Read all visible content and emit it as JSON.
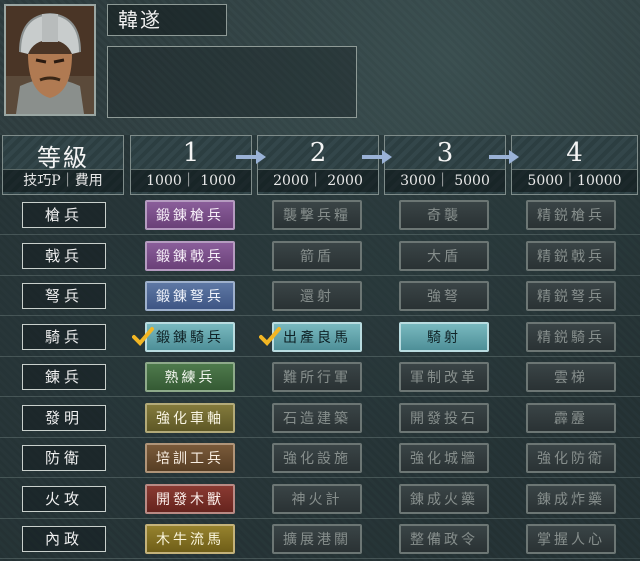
{
  "character": {
    "name": "韓遂"
  },
  "header": {
    "level_label": "等級",
    "cost_label": "技巧P｜費用",
    "levels": [
      {
        "level": "1",
        "cost": "1000｜ 1000"
      },
      {
        "level": "2",
        "cost": "2000｜ 2000"
      },
      {
        "level": "3",
        "cost": "3000｜ 5000"
      },
      {
        "level": "4",
        "cost": "5000｜10000"
      }
    ]
  },
  "rows": [
    {
      "label": "槍兵",
      "techs": [
        "鍛錬槍兵",
        "襲撃兵糧",
        "奇襲",
        "精鋭槍兵"
      ]
    },
    {
      "label": "戟兵",
      "techs": [
        "鍛錬戟兵",
        "箭盾",
        "大盾",
        "精鋭戟兵"
      ]
    },
    {
      "label": "弩兵",
      "techs": [
        "鍛錬弩兵",
        "還射",
        "強弩",
        "精鋭弩兵"
      ]
    },
    {
      "label": "騎兵",
      "techs": [
        "鍛錬騎兵",
        "出產良馬",
        "騎射",
        "精鋭騎兵"
      ]
    },
    {
      "label": "錬兵",
      "techs": [
        "熟練兵",
        "難所行軍",
        "軍制改革",
        "雲梯"
      ]
    },
    {
      "label": "發明",
      "techs": [
        "強化車軸",
        "石造建築",
        "開發投石",
        "霹靂"
      ]
    },
    {
      "label": "防衛",
      "techs": [
        "培訓工兵",
        "強化設施",
        "強化城牆",
        "強化防衛"
      ]
    },
    {
      "label": "火攻",
      "techs": [
        "開發木獸",
        "神火計",
        "錬成火藥",
        "錬成炸藥"
      ]
    },
    {
      "label": "內政",
      "techs": [
        "木牛流馬",
        "擴展港關",
        "整備政令",
        "掌握人心"
      ]
    }
  ],
  "researched": [
    "鍛錬騎兵",
    "出產良馬"
  ],
  "colors": {
    "available_level1": [
      "purple",
      "purple",
      "blue",
      "teal",
      "green",
      "olive",
      "brown",
      "red",
      "gold"
    ],
    "available_level3_cavalry": "teal",
    "locked": "dark"
  }
}
